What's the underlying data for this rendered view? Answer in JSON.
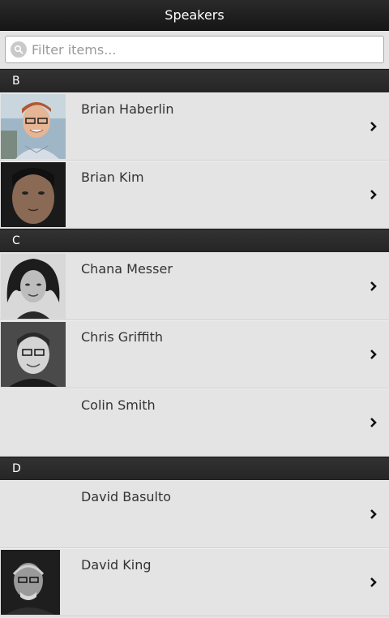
{
  "header": {
    "title": "Speakers"
  },
  "search": {
    "placeholder": "Filter items..."
  },
  "groups": [
    {
      "letter": "B",
      "items": [
        {
          "name": "Brian Haberlin",
          "photo": "portrait-color"
        },
        {
          "name": "Brian Kim",
          "photo": "portrait-dark"
        }
      ]
    },
    {
      "letter": "C",
      "items": [
        {
          "name": "Chana Messer",
          "photo": "portrait-bw"
        },
        {
          "name": "Chris Griffith",
          "photo": "portrait-bw"
        },
        {
          "name": "Colin Smith",
          "photo": ""
        }
      ]
    },
    {
      "letter": "D",
      "items": [
        {
          "name": "David Basulto",
          "photo": ""
        },
        {
          "name": "David King",
          "photo": "portrait-dark"
        }
      ]
    }
  ]
}
